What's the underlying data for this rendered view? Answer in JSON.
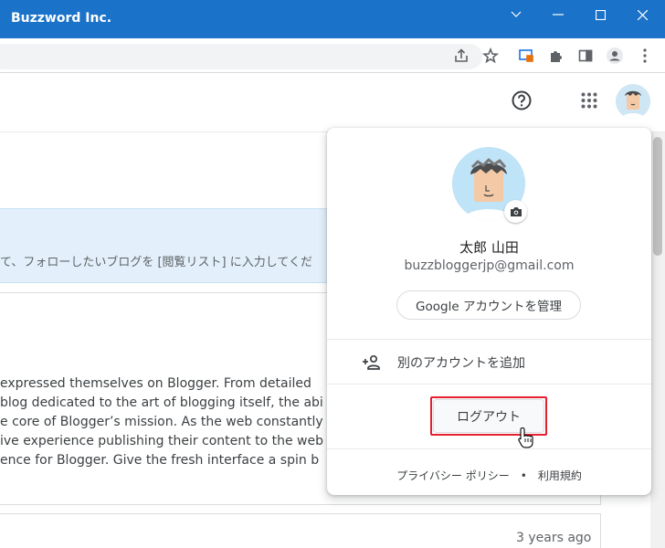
{
  "window": {
    "title": "Buzzword Inc."
  },
  "colors": {
    "titlebar": "#1a73c8",
    "banner": "#e3f0fb",
    "highlight": "#e5202e"
  },
  "toolbar": {
    "icons": [
      "share-icon",
      "bookmark-star-icon",
      "extension-cast-icon",
      "puzzle-icon",
      "side-panel-icon",
      "profile-icon",
      "kebab-menu-icon"
    ]
  },
  "header": {
    "icons": [
      "help-icon",
      "apps-grid-icon",
      "account-avatar"
    ]
  },
  "background": {
    "banner_text": "て、フォローしたいブログを [閲覧リスト] に入力してくだ",
    "post_lines": [
      "expressed themselves on Blogger. From detailed",
      "blog dedicated to the art of blogging itself, the abi",
      "e core of Blogger’s mission. As the web constantly",
      "ive experience publishing their content to the web",
      "ence for Blogger. Give the fresh interface a spin b"
    ],
    "time_ago": "3 years ago"
  },
  "account_popup": {
    "name": "太郎 山田",
    "email": "buzzbloggerjp@gmail.com",
    "manage_label": "Google アカウントを管理",
    "add_account_label": "別のアカウントを追加",
    "logout_label": "ログアウト",
    "privacy_label": "プライバシー ポリシー",
    "separator": "•",
    "terms_label": "利用規約"
  }
}
